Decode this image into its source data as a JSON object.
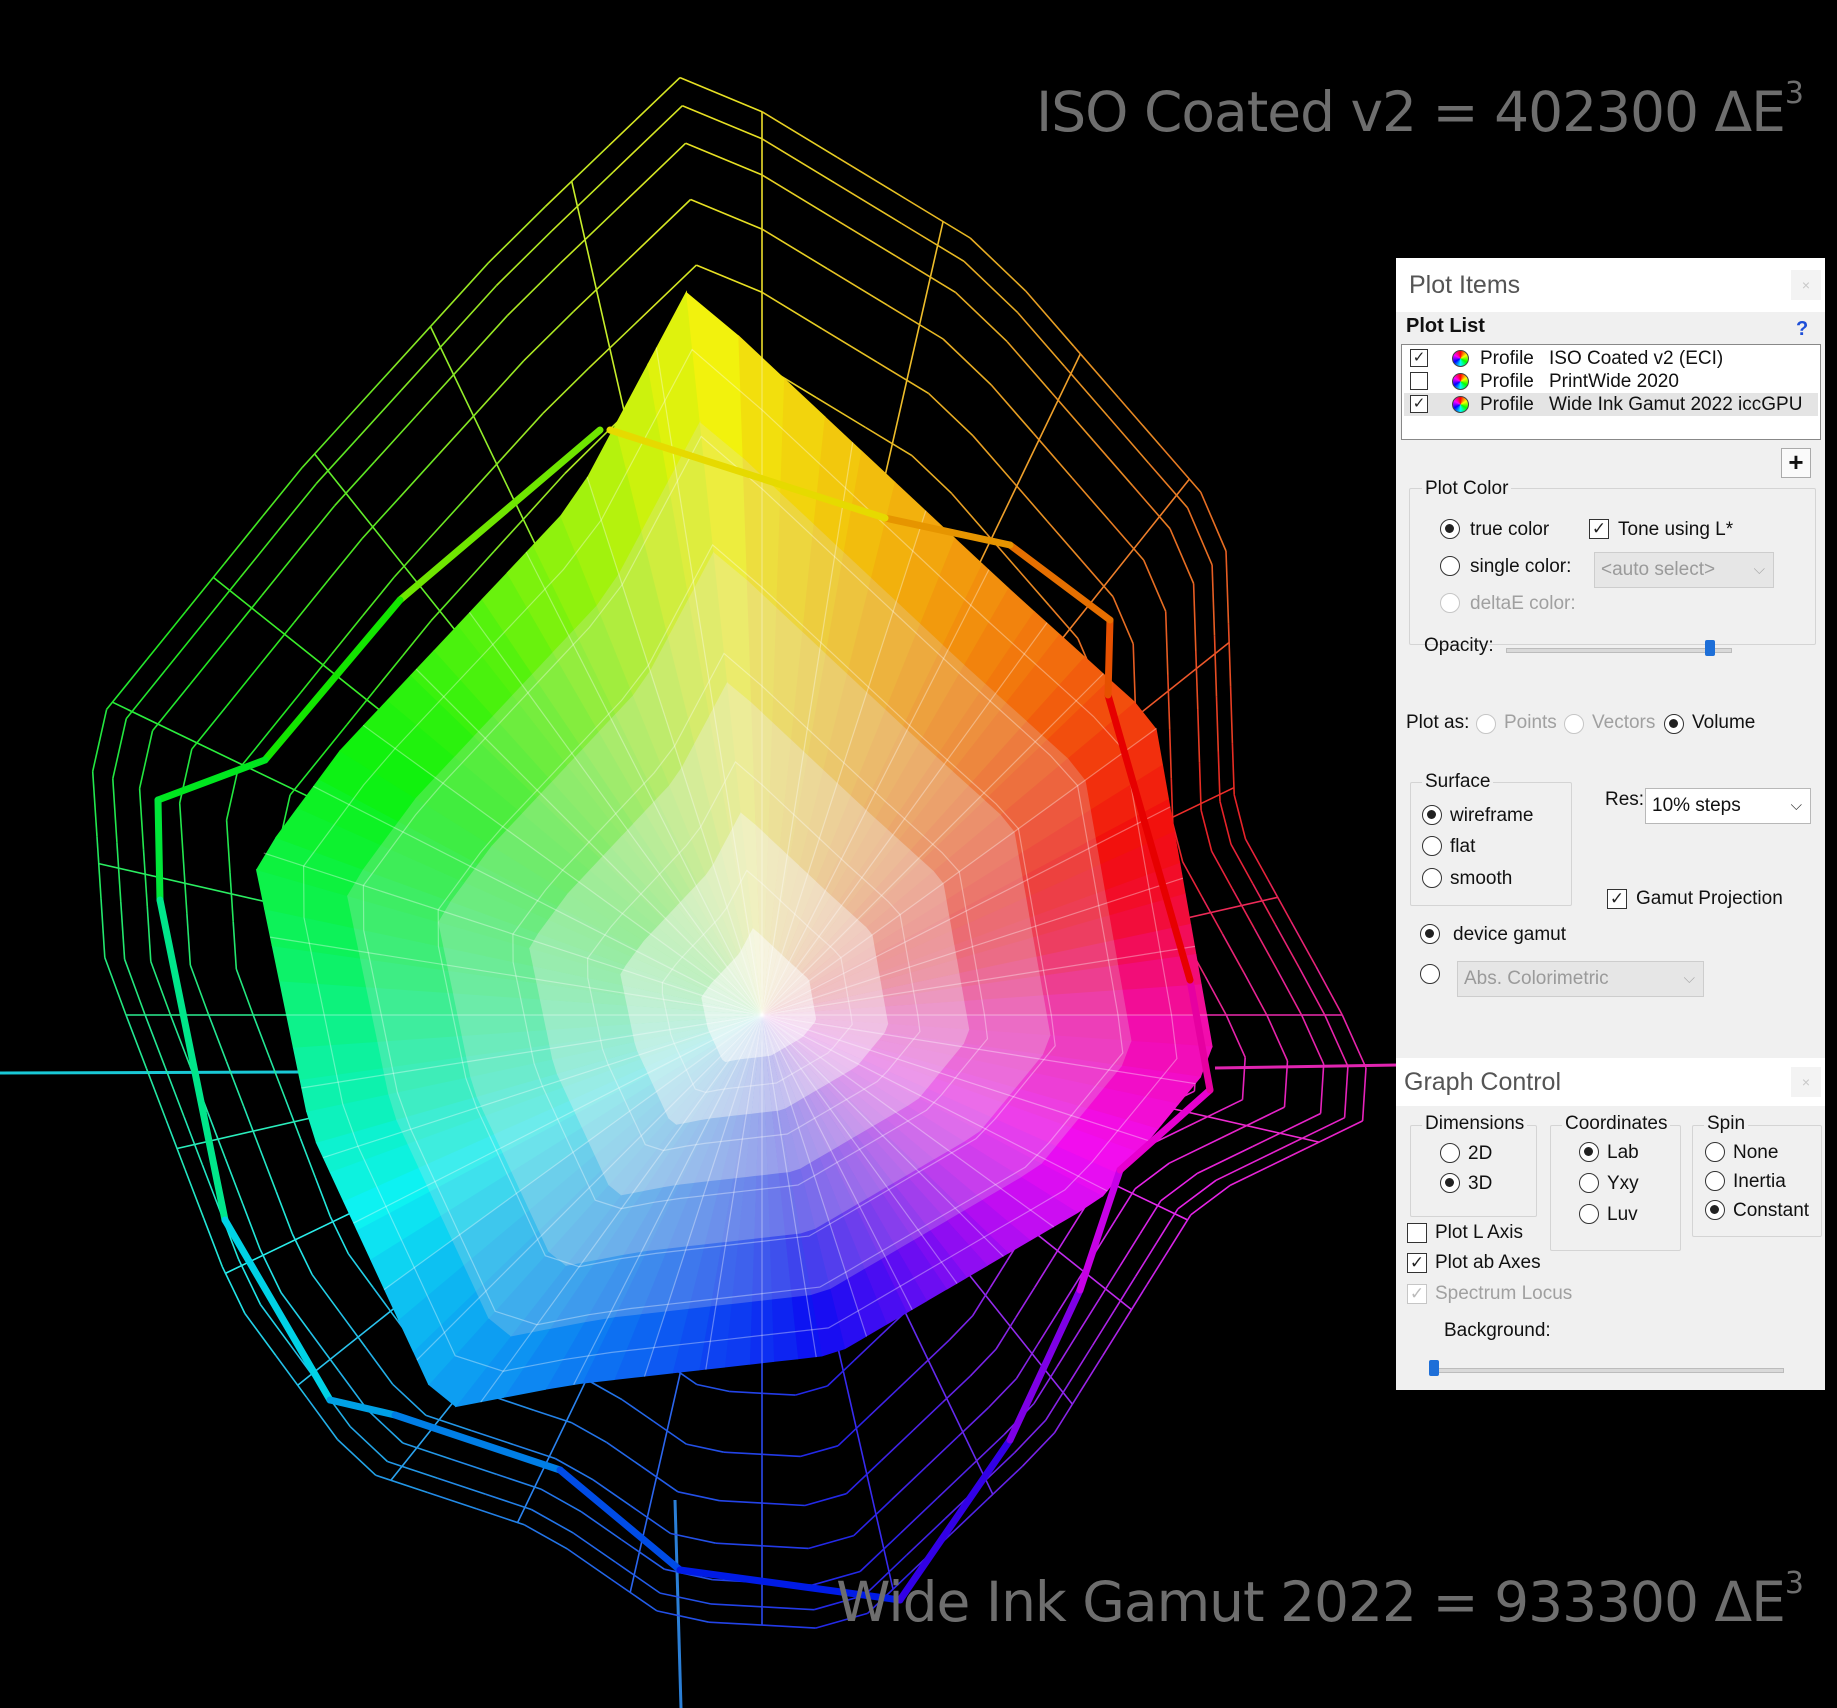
{
  "captions": {
    "top": {
      "text": "ISO Coated v2 = 402300 ΔE",
      "exp": "3"
    },
    "bottom": {
      "text": "Wide Ink Gamut 2022 = 933300 ΔE",
      "exp": "3"
    }
  },
  "plot_items": {
    "title": "Plot Items",
    "close": "×",
    "plot_list_label": "Plot List",
    "help": "?",
    "rows": [
      {
        "checked": true,
        "type": "Profile",
        "name": "ISO Coated v2 (ECI)",
        "selected": false
      },
      {
        "checked": false,
        "type": "Profile",
        "name": "PrintWide 2020",
        "selected": false
      },
      {
        "checked": true,
        "type": "Profile",
        "name": "Wide Ink Gamut 2022 iccGPU",
        "selected": true
      }
    ],
    "add_button": "+",
    "plot_color": {
      "label": "Plot Color",
      "true_color": "true color",
      "single_color": "single color:",
      "delta_e_color": "deltaE color:",
      "tone_using_l": "Tone using L*",
      "auto_select": "<auto select>",
      "opacity_label": "Opacity:",
      "opacity_level": 0.92
    },
    "plot_as": {
      "label": "Plot as:",
      "points": "Points",
      "vectors": "Vectors",
      "volume": "Volume",
      "selected": "Volume"
    },
    "surface": {
      "label": "Surface",
      "wireframe": "wireframe",
      "flat": "flat",
      "smooth": "smooth",
      "selected": "wireframe"
    },
    "res": {
      "label": "Res:",
      "value": "10% steps"
    },
    "gamut_projection": {
      "label": "Gamut Projection",
      "checked": true
    },
    "device_gamut": "device gamut",
    "intent": "Abs. Colorimetric"
  },
  "graph_control": {
    "title": "Graph Control",
    "close": "×",
    "dimensions": {
      "label": "Dimensions",
      "d2": "2D",
      "d3": "3D",
      "selected": "3D"
    },
    "coordinates": {
      "label": "Coordinates",
      "lab": "Lab",
      "yxy": "Yxy",
      "luv": "Luv",
      "selected": "Lab"
    },
    "spin": {
      "label": "Spin",
      "none": "None",
      "inertia": "Inertia",
      "constant": "Constant",
      "selected": "Constant"
    },
    "plot_l_axis": {
      "label": "Plot L Axis",
      "checked": false
    },
    "plot_ab_axes": {
      "label": "Plot ab Axes",
      "checked": true
    },
    "spectrum_locus": {
      "label": "Spectrum Locus",
      "checked": true,
      "disabled": true
    },
    "background_label": "Background:",
    "background_level": 0.0
  },
  "colors": {
    "background": "#000000",
    "caption": "#6e6e6e",
    "a_axis_green": "#19c8d6",
    "a_axis_red": "#e024b0",
    "b_axis": "#2b7fd6"
  }
}
